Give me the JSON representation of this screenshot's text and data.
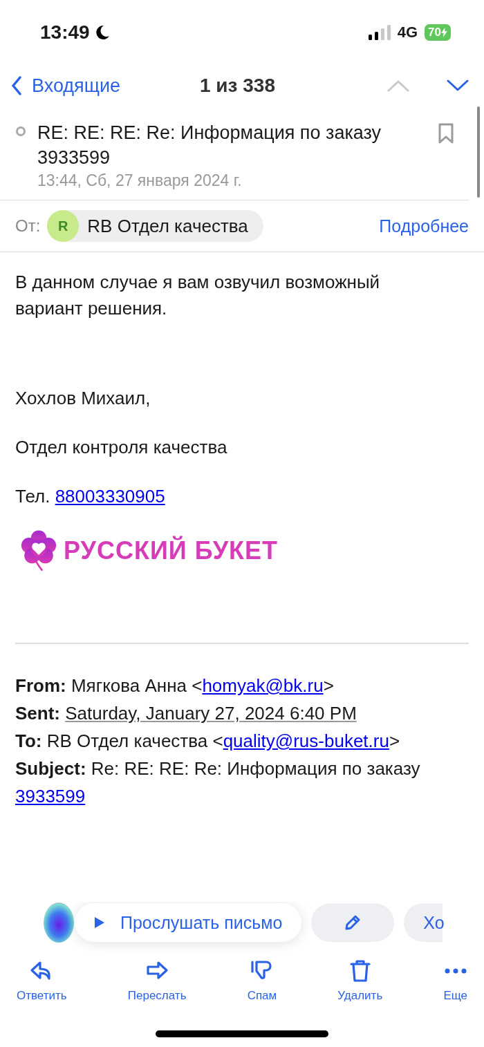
{
  "status_bar": {
    "time": "13:49",
    "network": "4G",
    "battery": "70"
  },
  "nav": {
    "back": "Входящие",
    "position": "1 из 338",
    "prev_enabled": false,
    "next_enabled": true
  },
  "message": {
    "subject": "RE: RE: RE: Re: Информация по заказу 3933599",
    "bookmarked": false,
    "date": "13:44, Сб, 27 января 2024 г.",
    "from_label": "От:",
    "sender_initial": "R",
    "sender_name": "RB Отдел качества",
    "details_link": "Подробнее"
  },
  "body": {
    "paragraphs": [
      "В данном случае я вам озвучил возможный вариант решения.",
      "Хохлов Михаил,",
      "Отдел контроля качества"
    ],
    "phone_label": "Тел.",
    "phone": "88003330905",
    "logo_text": "РУССКИЙ БУКЕТ"
  },
  "quoted": [
    {
      "label": "From:",
      "parts": [
        {
          "kind": "plain",
          "text": "Мягкова Анна <"
        },
        {
          "kind": "link",
          "text": "homyak@bk.ru"
        },
        {
          "kind": "plain",
          "text": ">"
        }
      ]
    },
    {
      "label": "Sent:",
      "parts": [
        {
          "kind": "date",
          "text": "Saturday, January 27, 2024 6:40 PM"
        }
      ]
    },
    {
      "label": "To:",
      "parts": [
        {
          "kind": "plain",
          "text": "RB Отдел качества <"
        },
        {
          "kind": "link",
          "text": "quality@rus-buket.ru"
        },
        {
          "kind": "plain",
          "text": ">"
        }
      ]
    },
    {
      "label": "Subject:",
      "parts": [
        {
          "kind": "plain",
          "text": "Re: RE: RE: Re: Информация по заказу "
        },
        {
          "kind": "link",
          "text": "3933599"
        }
      ]
    }
  ],
  "floating": {
    "listen": "Прослушать письмо",
    "chip_cut": "Хо"
  },
  "toolbar": [
    {
      "label": "Ответить"
    },
    {
      "label": "Переслать"
    },
    {
      "label": "Спам"
    },
    {
      "label": "Удалить"
    },
    {
      "label": "Еще"
    }
  ]
}
